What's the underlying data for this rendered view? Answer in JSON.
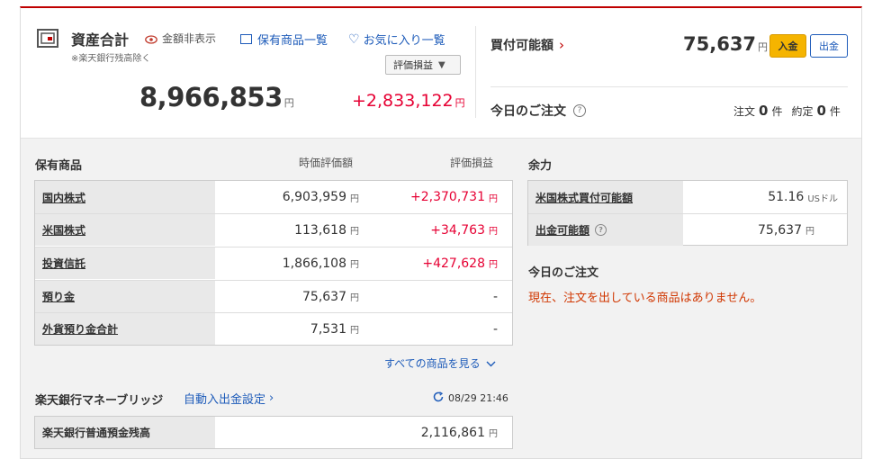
{
  "assets": {
    "title": "資産合計",
    "hide_amount_label": "金額非表示",
    "note": "※楽天銀行残高除く",
    "holdings_link": "保有商品一覧",
    "favorites_link": "お気に入り一覧",
    "eval_select": "評価損益",
    "total": "8,966,853",
    "total_unit": "円",
    "gain": "+2,833,122",
    "gain_unit": "円"
  },
  "buying_power": {
    "label": "買付可能額",
    "value": "75,637",
    "unit": "円",
    "deposit_button": "入金",
    "withdraw_button": "出金"
  },
  "today_orders": {
    "label": "今日のご注文",
    "order_label": "注文",
    "order_count": "0",
    "fill_label": "約定",
    "fill_count": "0",
    "unit": "件"
  },
  "holdings": {
    "heading": "保有商品",
    "col_value": "時価評価額",
    "col_gain": "評価損益",
    "unit": "円",
    "rows": [
      {
        "name": "国内株式",
        "value": "6,903,959",
        "gain": "+2,370,731",
        "gain_unit": "円"
      },
      {
        "name": "米国株式",
        "value": "113,618",
        "gain": "+34,763",
        "gain_unit": "円"
      },
      {
        "name": "投資信託",
        "value": "1,866,108",
        "gain": "+427,628",
        "gain_unit": "円"
      },
      {
        "name": "預り金",
        "value": "75,637",
        "gain": "-",
        "gain_unit": ""
      },
      {
        "name": "外貨預り金合計",
        "value": "7,531",
        "gain": "-",
        "gain_unit": ""
      }
    ],
    "see_all": "すべての商品を見る"
  },
  "bank": {
    "heading": "楽天銀行マネーブリッジ",
    "auto_link": "自動入出金設定",
    "timestamp": "08/29 21:46",
    "row_label": "楽天銀行普通預金残高",
    "row_value": "2,116,861",
    "unit": "円"
  },
  "surplus": {
    "heading": "余力",
    "rows": [
      {
        "name": "米国株式買付可能額",
        "value": "51.16",
        "unit": "USドル"
      },
      {
        "name": "出金可能額",
        "value": "75,637",
        "unit": "円"
      }
    ],
    "orders_heading": "今日のご注文",
    "orders_message": "現在、注文を出している商品はありません。"
  },
  "colors": {
    "accent_red": "#e60033",
    "link_blue": "#1d5bb9",
    "deposit_yellow": "#f5b400"
  }
}
